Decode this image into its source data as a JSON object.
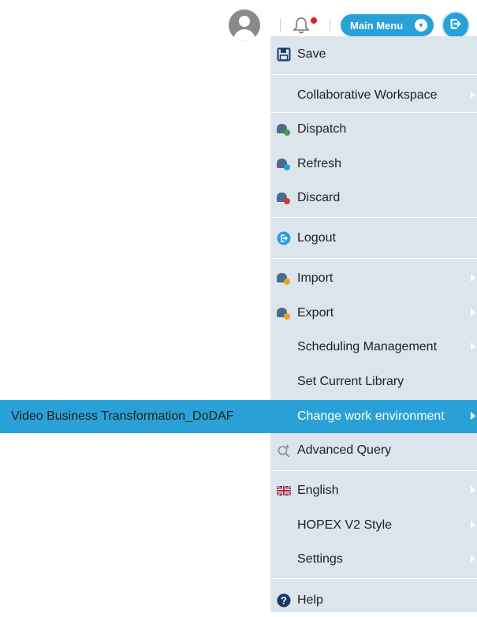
{
  "header": {
    "main_menu_label": "Main Menu"
  },
  "menu": {
    "items": [
      {
        "label": "Save",
        "icon": "save-icon"
      },
      {
        "label": "Collaborative Workspace",
        "icon": ""
      },
      {
        "label": "Dispatch",
        "icon": "dispatch-icon"
      },
      {
        "label": "Refresh",
        "icon": "refresh-icon"
      },
      {
        "label": "Discard",
        "icon": "discard-icon"
      },
      {
        "label": "Logout",
        "icon": "logout-icon"
      },
      {
        "label": "Import",
        "icon": "import-icon"
      },
      {
        "label": "Export",
        "icon": "export-icon"
      },
      {
        "label": "Scheduling Management",
        "icon": ""
      },
      {
        "label": "Set Current Library",
        "icon": ""
      },
      {
        "label": "Change work environment",
        "icon": ""
      },
      {
        "label": "Advanced Query",
        "icon": "advanced-query-icon"
      },
      {
        "label": "English",
        "icon": "uk-flag-icon"
      },
      {
        "label": "HOPEX V2 Style",
        "icon": ""
      },
      {
        "label": "Settings",
        "icon": ""
      },
      {
        "label": "Help",
        "icon": "help-icon"
      }
    ]
  },
  "submenu": {
    "environment_label": "Video Business Transformation_DoDAF"
  },
  "colors": {
    "accent": "#2aa1d6",
    "menu_bg": "#dce4ec",
    "notification": "#e0201f"
  }
}
